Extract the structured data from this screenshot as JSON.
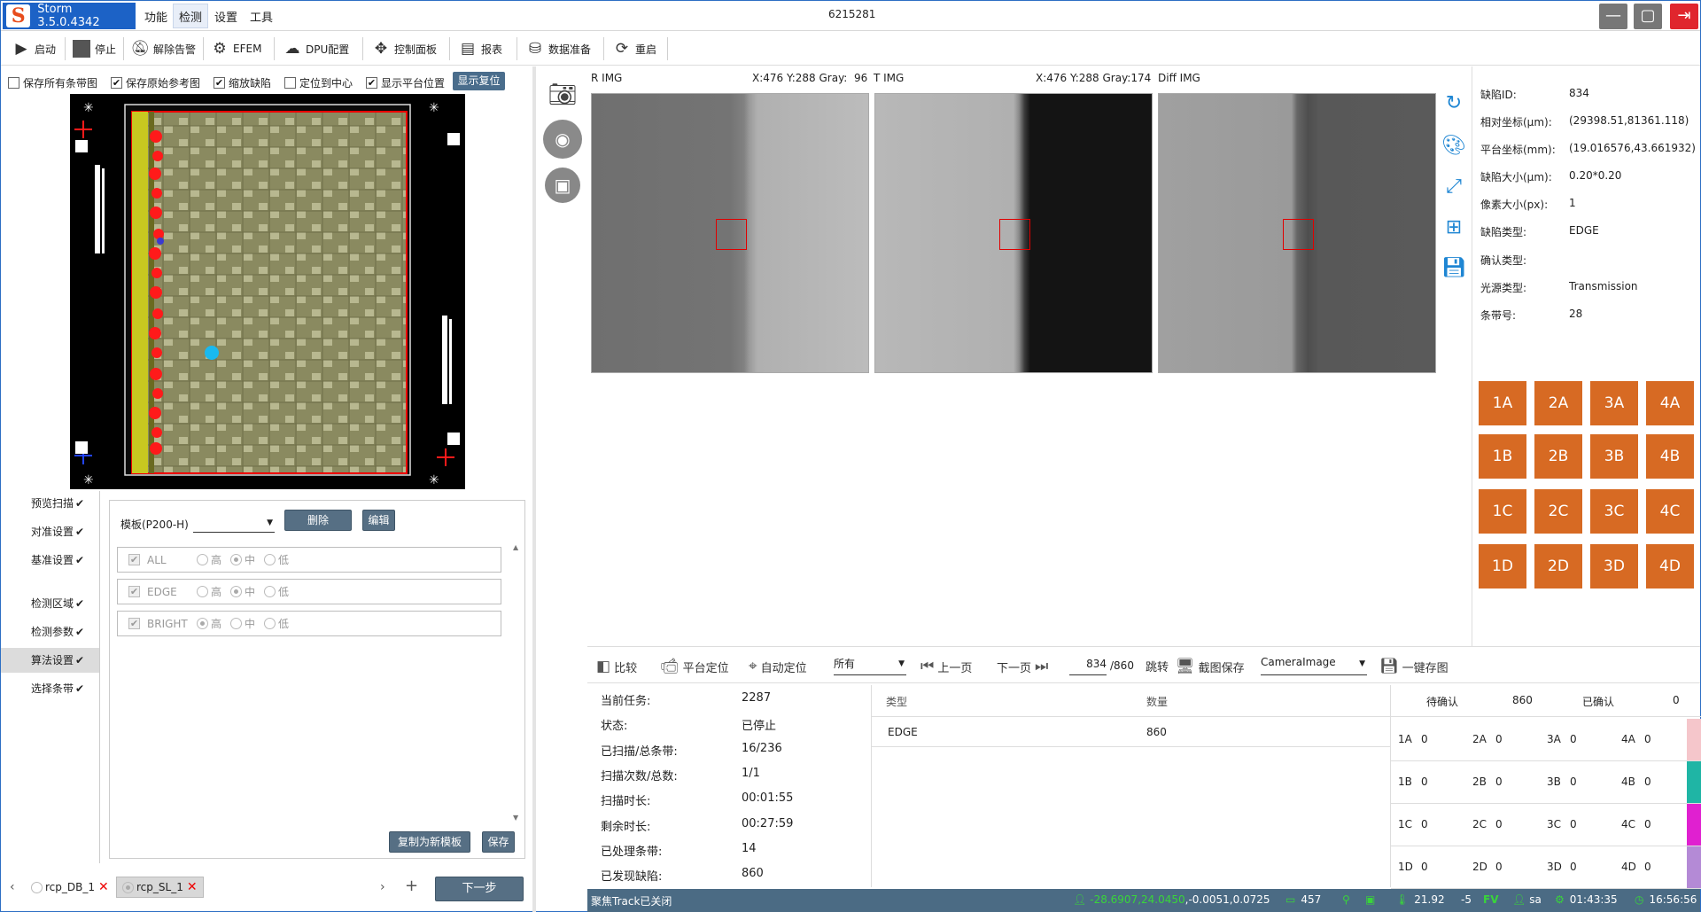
{
  "app": {
    "title": "Storm 3.5.0.4342",
    "window_id": "6215281"
  },
  "menu": [
    {
      "label": "功能"
    },
    {
      "label": "检测"
    },
    {
      "label": "设置"
    },
    {
      "label": "工具"
    }
  ],
  "toolbar": [
    {
      "label": "启动",
      "icon": "play-icon"
    },
    {
      "label": "停止",
      "icon": "stop-icon"
    },
    {
      "label": "解除告警",
      "icon": "bell-off-icon"
    },
    {
      "label": "EFEM",
      "icon": "robot-arm-icon"
    },
    {
      "label": "DPU配置",
      "icon": "cloud-gear-icon"
    },
    {
      "label": "控制面板",
      "icon": "move-icon"
    },
    {
      "label": "报表",
      "icon": "report-icon"
    },
    {
      "label": "数据准备",
      "icon": "database-icon"
    },
    {
      "label": "重启",
      "icon": "refresh-icon"
    }
  ],
  "options": [
    {
      "label": "保存所有条带图",
      "checked": false
    },
    {
      "label": "保存原始参考图",
      "checked": true
    },
    {
      "label": "缩放缺陷",
      "checked": true
    },
    {
      "label": "定位到中心",
      "checked": false
    },
    {
      "label": "显示平台位置",
      "checked": true
    }
  ],
  "show_reset_label": "显示复位",
  "nav": [
    {
      "label": "预览扫描",
      "done": true
    },
    {
      "label": "对准设置",
      "done": true
    },
    {
      "label": "基准设置",
      "done": true
    },
    {
      "label": "检测区域",
      "done": true
    },
    {
      "label": "检测参数",
      "done": true
    },
    {
      "label": "算法设置",
      "done": true,
      "selected": true
    },
    {
      "label": "选择条带",
      "done": true
    }
  ],
  "check_mark": "✔",
  "algo": {
    "template_label": "模板(P200-H)",
    "template_value": "",
    "delete_label": "删除",
    "edit_label": "编辑",
    "levels": [
      "高",
      "中",
      "低"
    ],
    "rows": [
      {
        "name": "ALL",
        "selected": 1
      },
      {
        "name": "EDGE",
        "selected": 1
      },
      {
        "name": "BRIGHT",
        "selected": 0
      }
    ],
    "copy_label": "复制为新模板",
    "save_label": "保存"
  },
  "recipe_tabs": [
    {
      "label": "rcp_DB_1",
      "selected": false
    },
    {
      "label": "rcp_SL_1",
      "selected": true
    }
  ],
  "next_label": "下一步",
  "images": [
    {
      "name": "R IMG",
      "info": "X:476 Y:288 Gray:  96"
    },
    {
      "name": "T IMG",
      "info": "X:476 Y:288 Gray:174"
    },
    {
      "name": "Diff IMG",
      "info": ""
    }
  ],
  "defect": [
    {
      "label": "缺陷ID:",
      "value": "834"
    },
    {
      "label": "相对坐标(μm):",
      "value": "(29398.51,81361.118)"
    },
    {
      "label": "平台坐标(mm):",
      "value": "(19.016576,43.661932)"
    },
    {
      "label": "缺陷大小(μm):",
      "value": "0.20*0.20"
    },
    {
      "label": "像素大小(px):",
      "value": "1"
    },
    {
      "label": "缺陷类型:",
      "value": "EDGE"
    },
    {
      "label": "确认类型:",
      "value": ""
    },
    {
      "label": "光源类型:",
      "value": "Transmission"
    },
    {
      "label": "条带号:",
      "value": "28"
    }
  ],
  "class_buttons": [
    "1A",
    "2A",
    "3A",
    "4A",
    "1B",
    "2B",
    "3B",
    "4B",
    "1C",
    "2C",
    "3C",
    "4C",
    "1D",
    "2D",
    "3D",
    "4D"
  ],
  "nav_bar": {
    "compare": "比较",
    "platform_pos": "平台定位",
    "auto_pos": "自动定位",
    "filter": "所有",
    "prev": "上一页",
    "next": "下一页",
    "page_current": "834",
    "page_total": "/860",
    "jump": "跳转",
    "screenshot": "截图保存",
    "camera": "CameraImage",
    "save_all": "一键存图"
  },
  "status": [
    {
      "label": "当前任务:",
      "value": "2287"
    },
    {
      "label": "状态:",
      "value": "已停止"
    },
    {
      "label": "已扫描/总条带:",
      "value": "16/236"
    },
    {
      "label": "扫描次数/总数:",
      "value": "1/1"
    },
    {
      "label": "扫描时长:",
      "value": "00:01:55"
    },
    {
      "label": "剩余时长:",
      "value": "00:27:59"
    },
    {
      "label": "已处理条带:",
      "value": "14"
    },
    {
      "label": "已发现缺陷:",
      "value": "860"
    }
  ],
  "type_table": {
    "headers": [
      "类型",
      "数量"
    ],
    "rows": [
      [
        "EDGE",
        "860"
      ]
    ]
  },
  "confirm": {
    "pending_label": "待确认",
    "pending": "860",
    "confirmed_label": "已确认",
    "confirmed": "0"
  },
  "class_counts": [
    [
      [
        "1A",
        "0"
      ],
      [
        "2A",
        "0"
      ],
      [
        "3A",
        "0"
      ],
      [
        "4A",
        "0"
      ]
    ],
    [
      [
        "1B",
        "0"
      ],
      [
        "2B",
        "0"
      ],
      [
        "3B",
        "0"
      ],
      [
        "4B",
        "0"
      ]
    ],
    [
      [
        "1C",
        "0"
      ],
      [
        "2C",
        "0"
      ],
      [
        "3C",
        "0"
      ],
      [
        "4C",
        "0"
      ]
    ],
    [
      [
        "1D",
        "0"
      ],
      [
        "2D",
        "0"
      ],
      [
        "3D",
        "0"
      ],
      [
        "4D",
        "0"
      ]
    ]
  ],
  "row_colors": [
    "#f5c6cb",
    "#1fb5a5",
    "#e020d0",
    "#b48ad6"
  ],
  "statusbar": {
    "focus": "聚焦Track已关闭",
    "coord_green": "-28.6907,24.0450",
    "coord_white": ",-0.0051,0.0725",
    "fps": "457",
    "temp": "21.92",
    "offset": "-5",
    "fv": "FV",
    "user": "sa",
    "elapsed": "01:43:35",
    "clock": "16:56:56"
  },
  "colors": {
    "accent": "#1c62c6",
    "orange": "#d76a23",
    "status_bg": "#4b6b84",
    "icon_blue": "#1f86d3"
  }
}
